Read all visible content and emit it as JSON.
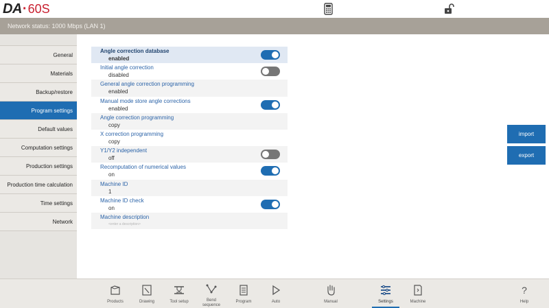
{
  "header": {
    "logo_brand": "DA",
    "logo_model": "60S",
    "calculator_icon": "calculator-icon",
    "lock_icon": "unlock-icon"
  },
  "status": {
    "text": "Network status: 1000 Mbps (LAN 1)"
  },
  "sidebar": {
    "items": [
      {
        "label": "General"
      },
      {
        "label": "Materials"
      },
      {
        "label": "Backup/restore"
      },
      {
        "label": "Program settings",
        "active": true
      },
      {
        "label": "Default values"
      },
      {
        "label": "Computation settings"
      },
      {
        "label": "Production settings"
      },
      {
        "label": "Production time calculation"
      },
      {
        "label": "Time settings"
      },
      {
        "label": "Network"
      }
    ]
  },
  "settings": [
    {
      "label": "Angle correction database",
      "value": "enabled",
      "toggle": "on",
      "selected": true
    },
    {
      "label": "Initial angle correction",
      "value": "disabled",
      "toggle": "off"
    },
    {
      "label": "General angle correction programming",
      "value": "enabled"
    },
    {
      "label": "Manual mode store angle corrections",
      "value": "enabled",
      "toggle": "on"
    },
    {
      "label": "Angle correction programming",
      "value": "copy"
    },
    {
      "label": "X correction programming",
      "value": "copy"
    },
    {
      "label": "Y1/Y2 independent",
      "value": "off",
      "toggle": "off"
    },
    {
      "label": "Recomputation of numerical values",
      "value": "on",
      "toggle": "on"
    },
    {
      "label": "Machine ID",
      "value": "1"
    },
    {
      "label": "Machine ID check",
      "value": "on",
      "toggle": "on"
    },
    {
      "label": "Machine description",
      "placeholder": "<enter a description>"
    }
  ],
  "actions": {
    "import_label": "import",
    "export_label": "export"
  },
  "toolbar": {
    "products": "Products",
    "drawing": "Drawing",
    "tool_setup": "Tool setup",
    "bend_sequence_1": "Bend",
    "bend_sequence_2": "sequence",
    "program": "Program",
    "auto": "Auto",
    "manual": "Manual",
    "settings": "Settings",
    "machine": "Machine",
    "help": "Help"
  },
  "colors": {
    "accent": "#1f6db2",
    "status_bar": "#a7a198",
    "brand_red": "#c8202f",
    "toggle_off": "#767676"
  }
}
